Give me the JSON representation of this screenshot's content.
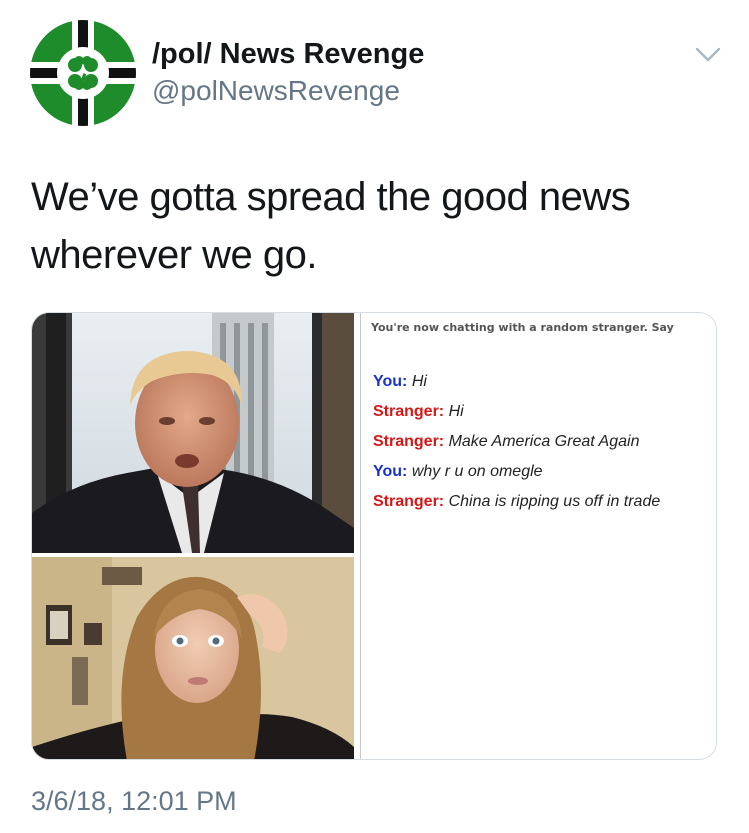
{
  "author": {
    "display_name": "/pol/ News Revenge",
    "handle": "@polNewsRevenge",
    "avatar_icon": "four-leaf-clover-cross-flag-icon"
  },
  "tweet": {
    "text": "We’ve gotta spread the good news wherever we go.",
    "timestamp": "3/6/18, 12:01 PM"
  },
  "media": {
    "chat": {
      "notice": "You're now chatting with a random stranger. Say",
      "messages": [
        {
          "speaker": "You:",
          "role": "you",
          "text": "Hi"
        },
        {
          "speaker": "Stranger:",
          "role": "stranger",
          "text": "Hi"
        },
        {
          "speaker": "Stranger:",
          "role": "stranger",
          "text": "Make America Great Again"
        },
        {
          "speaker": "You:",
          "role": "you",
          "text": "why r u on omegle"
        },
        {
          "speaker": "Stranger:",
          "role": "stranger",
          "text": "China is ripping us off in trade"
        }
      ]
    }
  },
  "colors": {
    "name": "#14171a",
    "secondary": "#657786",
    "chat_you": "#1a33c9",
    "chat_stranger": "#d01a1a",
    "avatar_green": "#1e8c2a"
  }
}
